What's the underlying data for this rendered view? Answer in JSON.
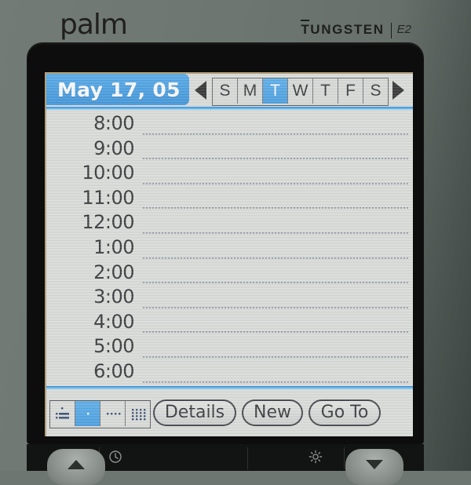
{
  "device": {
    "brand": "palm",
    "line": "TUNGSTEN",
    "model": "E2",
    "body_color": "#6e7672",
    "bezel_color": "#0c0d0c"
  },
  "screen": {
    "app": "date-book",
    "accent_color": "#2b90e0",
    "background_color": "#d9dbd8"
  },
  "titlebar": {
    "date": "May 17, 05",
    "prev_arrow": "triangle-left-icon",
    "next_arrow": "triangle-right-icon",
    "days": [
      {
        "label": "S",
        "selected": false
      },
      {
        "label": "M",
        "selected": false
      },
      {
        "label": "T",
        "selected": true
      },
      {
        "label": "W",
        "selected": false
      },
      {
        "label": "T",
        "selected": false
      },
      {
        "label": "F",
        "selected": false
      },
      {
        "label": "S",
        "selected": false
      }
    ]
  },
  "schedule": {
    "rows": [
      {
        "time": "8:00"
      },
      {
        "time": "9:00"
      },
      {
        "time": "10:00"
      },
      {
        "time": "11:00"
      },
      {
        "time": "12:00"
      },
      {
        "time": "1:00"
      },
      {
        "time": "2:00"
      },
      {
        "time": "3:00"
      },
      {
        "time": "4:00"
      },
      {
        "time": "5:00"
      },
      {
        "time": "6:00"
      }
    ]
  },
  "toolbar": {
    "views": [
      {
        "name": "agenda-view",
        "selected": false
      },
      {
        "name": "day-view",
        "selected": true
      },
      {
        "name": "week-view",
        "selected": false
      },
      {
        "name": "month-view",
        "selected": false
      }
    ],
    "buttons": {
      "details": "Details",
      "new": "New",
      "goto": "Go To"
    }
  },
  "hardware": {
    "clock_icon": "clock-icon",
    "brightness_icon": "brightness-icon",
    "up_button": "scroll-up-button",
    "down_button": "scroll-down-button"
  }
}
